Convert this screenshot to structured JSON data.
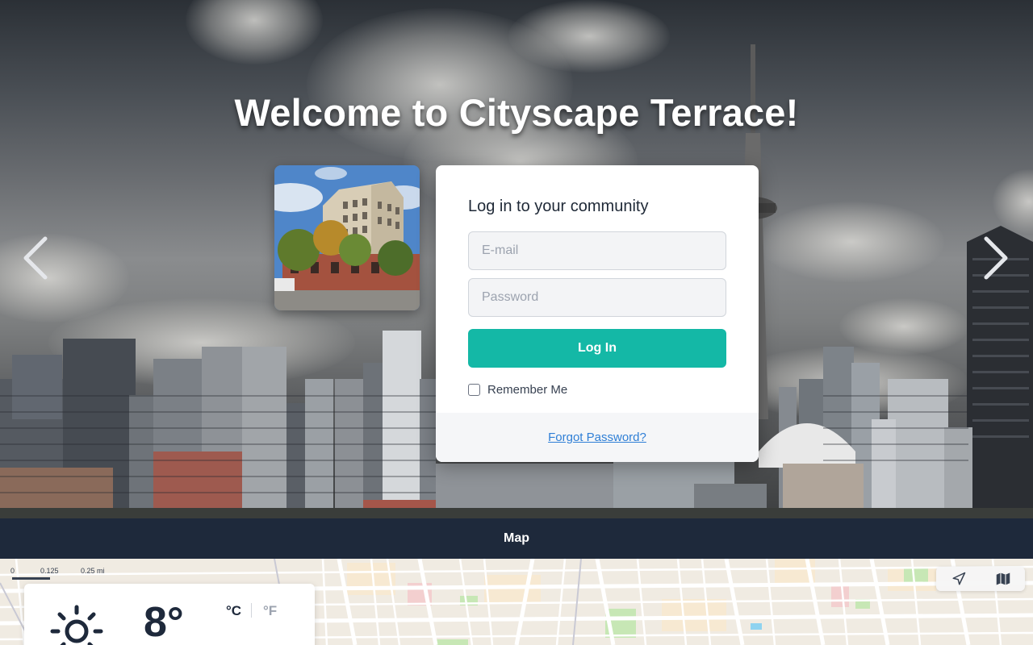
{
  "hero": {
    "title": "Welcome to Cityscape Terrace!"
  },
  "login": {
    "heading": "Log in to your community",
    "email_placeholder": "E-mail",
    "password_placeholder": "Password",
    "submit_label": "Log In",
    "remember_label": "Remember Me",
    "forgot_label": "Forgot Password?"
  },
  "map_bar": {
    "label": "Map"
  },
  "map": {
    "scale_labels": [
      "0",
      "0.125",
      "0.25 mi"
    ]
  },
  "weather": {
    "temperature": "8°",
    "unit_c": "°C",
    "unit_f": "°F",
    "icon": "sun-icon"
  },
  "colors": {
    "accent": "#14b8a6",
    "nav": "#1e293b",
    "link": "#2f7fd6"
  },
  "icons": {
    "prev": "chevron-left-icon",
    "next": "chevron-right-icon",
    "locate": "navigation-arrow-icon",
    "map_layers": "map-icon"
  }
}
